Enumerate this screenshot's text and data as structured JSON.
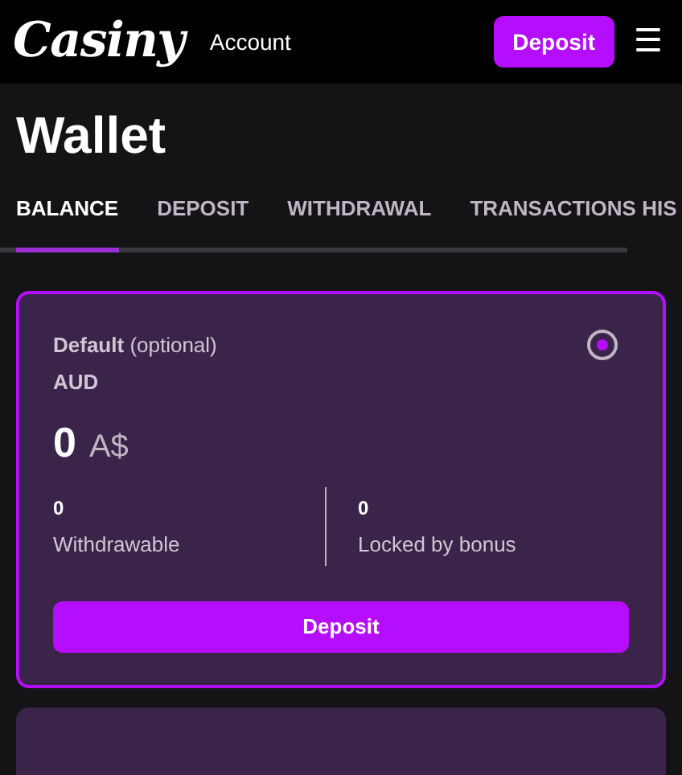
{
  "header": {
    "logo": "Casiny",
    "account_link": "Account",
    "deposit_button": "Deposit",
    "menu_icon": "☰"
  },
  "title": "Wallet",
  "tabs": [
    {
      "label": "BALANCE",
      "selected": true
    },
    {
      "label": "DEPOSIT",
      "selected": false
    },
    {
      "label": "WITHDRAWAL",
      "selected": false
    },
    {
      "label": "TRANSACTIONS HIS",
      "selected": false
    }
  ],
  "wallets": [
    {
      "name": "Default",
      "note": "(optional)",
      "currency": "AUD",
      "amount": "0",
      "symbol": "A$",
      "selected": true,
      "stats": [
        {
          "value": "0",
          "label": "Withdrawable"
        },
        {
          "value": "0",
          "label": "Locked by bonus"
        }
      ],
      "button": "Deposit"
    }
  ]
}
